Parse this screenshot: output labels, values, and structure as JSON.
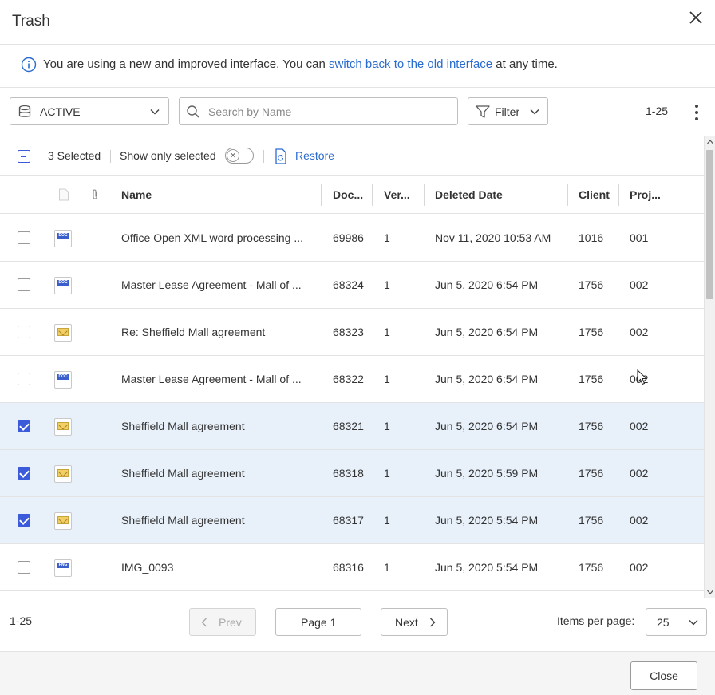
{
  "window": {
    "title": "Trash"
  },
  "notice": {
    "text_before": "You are using a new and improved interface. You can ",
    "link": "switch back to the old interface",
    "text_after": " at any time."
  },
  "toolbar": {
    "status_select": "ACTIVE",
    "search_placeholder": "Search by Name",
    "filter_label": "Filter",
    "range": "1-25"
  },
  "selection": {
    "count": "3 Selected",
    "show_only_selected": "Show only selected",
    "show_only_selected_on": false,
    "restore_label": "Restore"
  },
  "columns": [
    "Name",
    "Doc...",
    "Ver...",
    "Deleted Date",
    "Client",
    "Proj..."
  ],
  "rows": [
    {
      "checked": false,
      "type": "doc",
      "type_label": "DOC",
      "name": "Office Open XML word processing ...",
      "doc": "69986",
      "ver": "1",
      "deleted": "Nov 11, 2020 10:53 AM",
      "client": "1016",
      "project": "001"
    },
    {
      "checked": false,
      "type": "doc",
      "type_label": "DOC",
      "name": "Master Lease Agreement - Mall of ...",
      "doc": "68324",
      "ver": "1",
      "deleted": "Jun 5, 2020 6:54 PM",
      "client": "1756",
      "project": "002"
    },
    {
      "checked": false,
      "type": "email",
      "type_label": "",
      "name": "Re: Sheffield Mall agreement",
      "doc": "68323",
      "ver": "1",
      "deleted": "Jun 5, 2020 6:54 PM",
      "client": "1756",
      "project": "002"
    },
    {
      "checked": false,
      "type": "doc",
      "type_label": "DOC",
      "name": "Master Lease Agreement - Mall of ...",
      "doc": "68322",
      "ver": "1",
      "deleted": "Jun 5, 2020 6:54 PM",
      "client": "1756",
      "project": "002"
    },
    {
      "checked": true,
      "type": "email",
      "type_label": "",
      "name": "Sheffield Mall agreement",
      "doc": "68321",
      "ver": "1",
      "deleted": "Jun 5, 2020 6:54 PM",
      "client": "1756",
      "project": "002"
    },
    {
      "checked": true,
      "type": "email",
      "type_label": "",
      "name": "Sheffield Mall agreement",
      "doc": "68318",
      "ver": "1",
      "deleted": "Jun 5, 2020 5:59 PM",
      "client": "1756",
      "project": "002"
    },
    {
      "checked": true,
      "type": "email",
      "type_label": "",
      "name": "Sheffield Mall agreement",
      "doc": "68317",
      "ver": "1",
      "deleted": "Jun 5, 2020 5:54 PM",
      "client": "1756",
      "project": "002"
    },
    {
      "checked": false,
      "type": "png",
      "type_label": "PNG",
      "name": "IMG_0093",
      "doc": "68316",
      "ver": "1",
      "deleted": "Jun 5, 2020 5:54 PM",
      "client": "1756",
      "project": "002"
    }
  ],
  "pager": {
    "range": "1-25",
    "prev": "Prev",
    "page": "Page 1",
    "next": "Next",
    "items_per_page_label": "Items per page:",
    "items_per_page": "25"
  },
  "footer": {
    "close": "Close"
  },
  "colors": {
    "accent": "#3b5bdb",
    "link": "#2a6bd0",
    "selected_row": "#e8f1fa"
  }
}
